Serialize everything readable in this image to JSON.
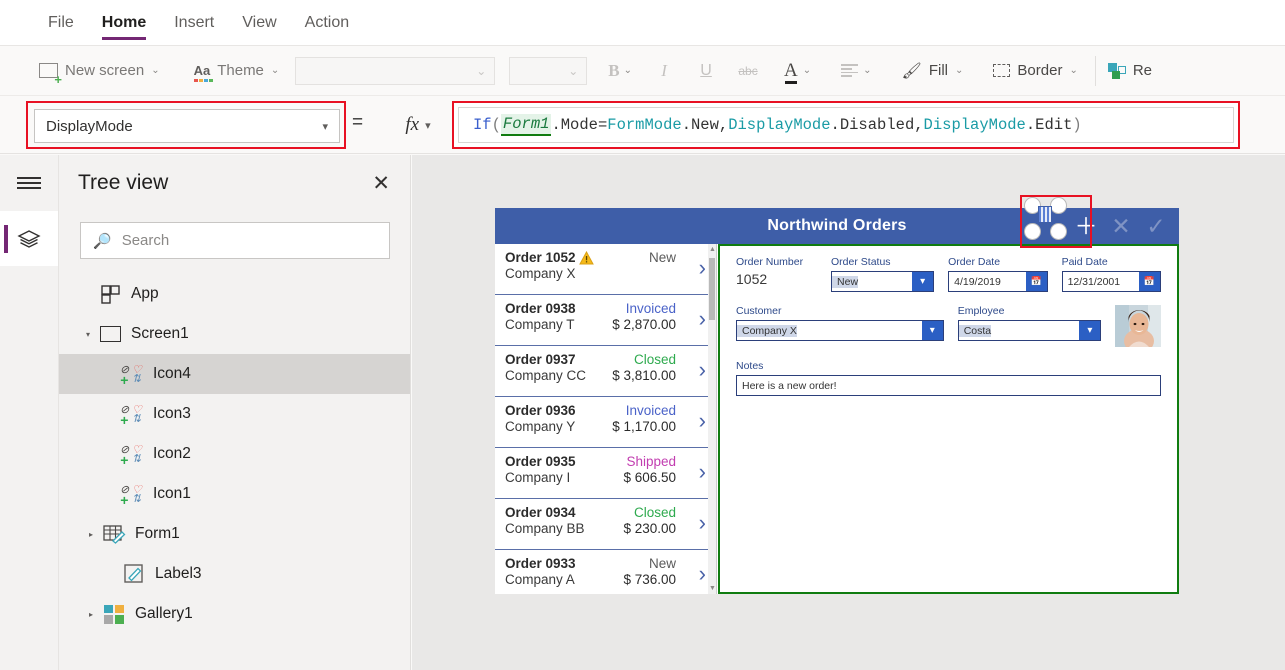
{
  "menu": {
    "tabs": [
      {
        "label": "File",
        "active": false
      },
      {
        "label": "Home",
        "active": true
      },
      {
        "label": "Insert",
        "active": false
      },
      {
        "label": "View",
        "active": false
      },
      {
        "label": "Action",
        "active": false
      }
    ]
  },
  "ribbon": {
    "new_screen": "New screen",
    "theme": "Theme",
    "font_family_value": "",
    "font_size_value": "",
    "bold": "B",
    "italic": "I",
    "underline": "U",
    "strikethrough": "abc",
    "font_color": "A",
    "align": "align",
    "fill": "Fill",
    "border": "Border",
    "reorder": "Re",
    "chevron": "⌄"
  },
  "formula_bar": {
    "property_value": "DisplayMode",
    "equals": "=",
    "fx": "fx",
    "formula_text": "If( Form1.Mode = FormMode.New, DisplayMode.Disabled, DisplayMode.Edit )",
    "tokens": [
      {
        "t": "If",
        "k": "fn"
      },
      {
        "t": "(",
        "k": "par"
      },
      {
        "t": " ",
        "k": "txt"
      },
      {
        "t": "Form1",
        "k": "ctrl"
      },
      {
        "t": ".Mode",
        "k": "op"
      },
      {
        "t": " = ",
        "k": "op"
      },
      {
        "t": "FormMode",
        "k": "enum"
      },
      {
        "t": ".New,",
        "k": "op"
      },
      {
        "t": " ",
        "k": "txt"
      },
      {
        "t": "DisplayMode",
        "k": "enum"
      },
      {
        "t": ".Disabled,",
        "k": "op"
      },
      {
        "t": " ",
        "k": "txt"
      },
      {
        "t": "DisplayMode",
        "k": "enum"
      },
      {
        "t": ".Edit",
        "k": "op"
      },
      {
        "t": " ",
        "k": "txt"
      },
      {
        "t": ")",
        "k": "par"
      }
    ],
    "highlight_color": "#e81123"
  },
  "rail": {
    "hamburger": "menu-icon",
    "layers": "layers-icon"
  },
  "tree": {
    "title": "Tree view",
    "close": "✕",
    "search_placeholder": "Search",
    "items": [
      {
        "label": "App",
        "level": 1,
        "arrow": "",
        "icon": "app-icon",
        "selected": false
      },
      {
        "label": "Screen1",
        "level": 1,
        "arrow": "◢",
        "icon": "screen-icon",
        "selected": false
      },
      {
        "label": "Icon4",
        "level": 2,
        "arrow": "",
        "icon": "icon-control-icon",
        "selected": true
      },
      {
        "label": "Icon3",
        "level": 2,
        "arrow": "",
        "icon": "icon-control-icon",
        "selected": false
      },
      {
        "label": "Icon2",
        "level": 2,
        "arrow": "",
        "icon": "icon-control-icon",
        "selected": false
      },
      {
        "label": "Icon1",
        "level": 2,
        "arrow": "",
        "icon": "icon-control-icon",
        "selected": false
      },
      {
        "label": "Form1",
        "level": 2,
        "arrow": "▸",
        "icon": "form-icon",
        "selected": false
      },
      {
        "label": "Label3",
        "level": 2,
        "arrow": "",
        "icon": "label-icon",
        "selected": false
      },
      {
        "label": "Gallery1",
        "level": 2,
        "arrow": "▸",
        "icon": "gallery-icon",
        "selected": false
      }
    ]
  },
  "app_preview": {
    "header_title": "Northwind Orders",
    "header_color": "#3e5ea8",
    "actions": [
      {
        "name": "add-icon",
        "glyph": "＋",
        "enabled": true
      },
      {
        "name": "cancel-icon",
        "glyph": "✕",
        "enabled": false
      },
      {
        "name": "confirm-icon",
        "glyph": "✓",
        "enabled": false
      }
    ],
    "gallery": {
      "items": [
        {
          "order": "Order 1052",
          "warn": true,
          "status": "New",
          "status_color": "#5a5a5a",
          "company": "Company X",
          "amount": ""
        },
        {
          "order": "Order 0938",
          "warn": false,
          "status": "Invoiced",
          "status_color": "#4a62c8",
          "company": "Company T",
          "amount": "$ 2,870.00"
        },
        {
          "order": "Order 0937",
          "warn": false,
          "status": "Closed",
          "status_color": "#2eaa4e",
          "company": "Company CC",
          "amount": "$ 3,810.00"
        },
        {
          "order": "Order 0936",
          "warn": false,
          "status": "Invoiced",
          "status_color": "#4a62c8",
          "company": "Company Y",
          "amount": "$ 1,170.00"
        },
        {
          "order": "Order 0935",
          "warn": false,
          "status": "Shipped",
          "status_color": "#c23db0",
          "company": "Company I",
          "amount": "$ 606.50"
        },
        {
          "order": "Order 0934",
          "warn": false,
          "status": "Closed",
          "status_color": "#2eaa4e",
          "company": "Company BB",
          "amount": "$ 230.00"
        },
        {
          "order": "Order 0933",
          "warn": false,
          "status": "New",
          "status_color": "#5a5a5a",
          "company": "Company A",
          "amount": "$ 736.00"
        }
      ]
    },
    "form": {
      "border_color": "#107c10",
      "fields": [
        {
          "label": "Order Number",
          "value": "1052",
          "type": "static"
        },
        {
          "label": "Order Status",
          "value": "New",
          "type": "dropdown"
        },
        {
          "label": "Order Date",
          "value": "4/19/2019",
          "type": "date"
        },
        {
          "label": "Paid Date",
          "value": "12/31/2001",
          "type": "date"
        },
        {
          "label": "Customer",
          "value": "Company X",
          "type": "dropdown"
        },
        {
          "label": "Employee",
          "value": "Costa",
          "type": "dropdown"
        },
        {
          "label": "Notes",
          "value": "Here is a new order!",
          "type": "text"
        }
      ],
      "photo": "employee-photo"
    }
  }
}
